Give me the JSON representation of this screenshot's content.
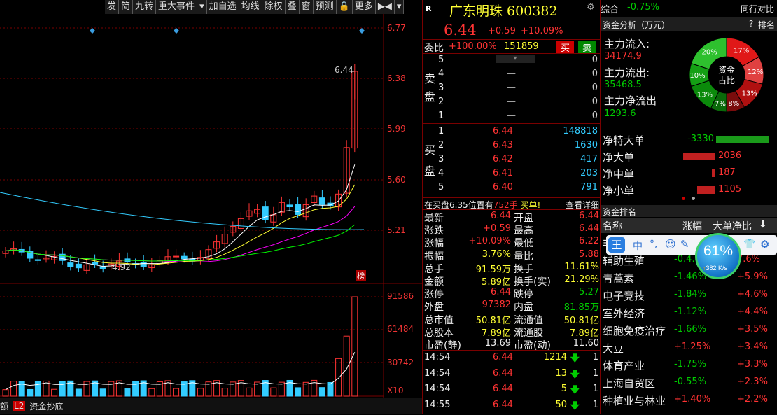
{
  "toolbar": {
    "items": [
      "发",
      "简",
      "九转",
      "重大事件",
      "▾",
      "加自选",
      "均线",
      "除权",
      "叠",
      "窗",
      "预测",
      "🔒",
      "更多",
      "▶◀",
      "▾"
    ]
  },
  "chart": {
    "price_ticks": [
      "6.77",
      "6.38",
      "5.99",
      "5.60",
      "5.21"
    ],
    "vol_ticks": [
      "91586",
      "61484",
      "30742",
      "X10"
    ],
    "low_label": "4.92",
    "high_label": "6.44",
    "bang": "榜"
  },
  "bottom_tabs": {
    "left": "额",
    "badge": "L2",
    "label": "资金抄底"
  },
  "header": {
    "r_label": "R",
    "name": "广东明珠 600382",
    "market": "综合",
    "market_change": "-0.75%",
    "compare": "同行对比"
  },
  "quote": {
    "price": "6.44",
    "change": "+0.59",
    "pct": "+10.09%"
  },
  "weibi": {
    "label": "委比",
    "pct": "+100.00%",
    "diff": "151859",
    "buy": "买",
    "sell": "卖"
  },
  "sell_orders": [
    {
      "lvl": "5",
      "price": "",
      "vol": "0"
    },
    {
      "lvl": "4",
      "price": "—",
      "vol": "0"
    },
    {
      "lvl": "3",
      "price": "—",
      "vol": "0"
    },
    {
      "lvl": "2",
      "price": "—",
      "vol": "0"
    },
    {
      "lvl": "1",
      "price": "—",
      "vol": "0"
    }
  ],
  "sell_label": [
    "卖",
    "盘"
  ],
  "buy_label": [
    "买",
    "盘"
  ],
  "buy_orders": [
    {
      "lvl": "1",
      "price": "6.44",
      "vol": "148818"
    },
    {
      "lvl": "2",
      "price": "6.43",
      "vol": "1630"
    },
    {
      "lvl": "3",
      "price": "6.42",
      "vol": "417"
    },
    {
      "lvl": "4",
      "price": "6.41",
      "vol": "203"
    },
    {
      "lvl": "5",
      "price": "6.40",
      "vol": "791"
    }
  ],
  "notice": {
    "text": "在买盘6.35位置有",
    "amount": "752手",
    "buy": "买单!",
    "detail": "查看详细"
  },
  "stats": [
    {
      "l1": "最新",
      "v1": "6.44",
      "c1": "red",
      "l2": "开盘",
      "v2": "6.44",
      "c2": "red"
    },
    {
      "l1": "涨跌",
      "v1": "+0.59",
      "c1": "red",
      "l2": "最高",
      "v2": "6.44",
      "c2": "red"
    },
    {
      "l1": "涨幅",
      "v1": "+10.09%",
      "c1": "red",
      "l2": "最低",
      "v2": "6.22",
      "c2": "red"
    },
    {
      "l1": "振幅",
      "v1": "3.76%",
      "c1": "yellow",
      "l2": "量比",
      "v2": "5.88",
      "c2": "red"
    },
    {
      "l1": "总手",
      "v1": "91.59万",
      "c1": "yellow",
      "l2": "换手",
      "v2": "11.61%",
      "c2": "yellow"
    },
    {
      "l1": "金额",
      "v1": "5.89亿",
      "c1": "yellow",
      "l2": "换手(实)",
      "v2": "21.29%",
      "c2": "yellow"
    },
    {
      "l1": "涨停",
      "v1": "6.44",
      "c1": "red",
      "l2": "跌停",
      "v2": "5.27",
      "c2": "green"
    },
    {
      "l1": "外盘",
      "v1": "97382",
      "c1": "red",
      "l2": "内盘",
      "v2": "81.85万",
      "c2": "green"
    },
    {
      "l1": "总市值",
      "v1": "50.81亿",
      "c1": "yellow",
      "l2": "流通值",
      "v2": "50.81亿",
      "c2": "yellow"
    },
    {
      "l1": "总股本",
      "v1": "7.89亿",
      "c1": "yellow",
      "l2": "流通股",
      "v2": "7.89亿",
      "c2": "yellow"
    },
    {
      "l1": "市盈(静)",
      "v1": "13.69",
      "c1": "white",
      "l2": "市盈(动)",
      "v2": "11.60",
      "c2": "white"
    }
  ],
  "ticks": [
    {
      "time": "14:54",
      "price": "6.44",
      "vol": "1214",
      "n": "1"
    },
    {
      "time": "14:54",
      "price": "6.44",
      "vol": "13",
      "n": "1"
    },
    {
      "time": "14:54",
      "price": "6.44",
      "vol": "5",
      "n": "1"
    },
    {
      "time": "14:55",
      "price": "6.44",
      "vol": "50",
      "n": "1"
    }
  ],
  "fund": {
    "title": "资金分析（万元）",
    "rank": "排名",
    "q": "?",
    "in_label": "主力流入:",
    "in_val": "34174.9",
    "out_label": "主力流出:",
    "out_val": "35468.5",
    "net_label": "主力净流出",
    "net_val": "1293.6",
    "pie_center": [
      "资金",
      "占比"
    ],
    "pie": [
      {
        "pct": 17,
        "label": "17%",
        "color": "#e01818"
      },
      {
        "pct": 12,
        "label": "12%",
        "color": "#e04040"
      },
      {
        "pct": 13,
        "label": "13%",
        "color": "#b01010"
      },
      {
        "pct": 8,
        "label": "8%",
        "color": "#7a0c0c"
      },
      {
        "pct": 7,
        "label": "7%",
        "color": "#0a6a0a"
      },
      {
        "pct": 13,
        "label": "13%",
        "color": "#0b8a0b"
      },
      {
        "pct": 10,
        "label": "10%",
        "color": "#14a014"
      },
      {
        "pct": 20,
        "label": "20%",
        "color": "#2ec02e"
      }
    ],
    "nets": [
      {
        "label": "净特大单",
        "value": "-3330",
        "frac": 0.88,
        "color": "#1a9a1a"
      },
      {
        "label": "净大单",
        "value": "2036",
        "frac": 0.53,
        "color": "#c02020"
      },
      {
        "label": "净中单",
        "value": "187",
        "frac": 0.05,
        "color": "#c02020"
      },
      {
        "label": "净小单",
        "value": "1105",
        "frac": 0.29,
        "color": "#c02020"
      }
    ]
  },
  "ranking": {
    "title": "资金排名",
    "cols": [
      "名称",
      "涨幅",
      "大单净比"
    ],
    "rows": [
      {
        "name": "非…",
        "chg": "",
        "net": ""
      },
      {
        "name": "辅助生殖",
        "chg": "-0.4…",
        "net": "7.6%"
      },
      {
        "name": "青蒿素",
        "chg": "-1.46%",
        "net": "+5.9%"
      },
      {
        "name": "电子竞技",
        "chg": "-1.84%",
        "net": "+4.6%"
      },
      {
        "name": "室外经济",
        "chg": "-1.12%",
        "net": "+4.4%"
      },
      {
        "name": "细胞免疫治疗",
        "chg": "-1.66%",
        "net": "+3.5%"
      },
      {
        "name": "大豆",
        "chg": "+1.25%",
        "net": "+3.4%"
      },
      {
        "name": "体育产业",
        "chg": "-1.75%",
        "net": "+3.3%"
      },
      {
        "name": "上海自贸区",
        "chg": "-0.55%",
        "net": "+2.3%"
      },
      {
        "name": "种植业与林业",
        "chg": "+1.40%",
        "net": "+2.2%"
      }
    ]
  },
  "ime": {
    "logo": "王",
    "items": [
      "中",
      "°,",
      "☺",
      "✎"
    ]
  },
  "speed": {
    "pct": "61%",
    "rate": "382 K/s"
  }
}
